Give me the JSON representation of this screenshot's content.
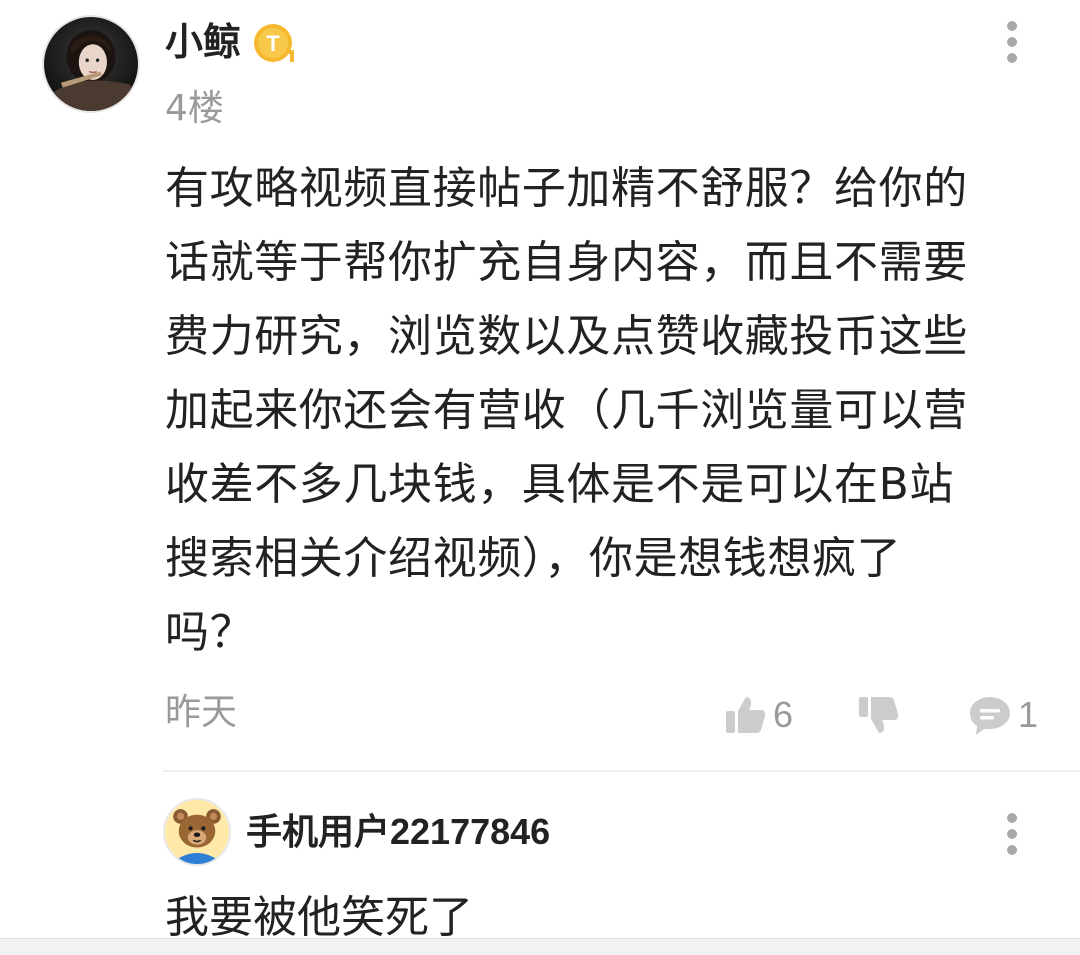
{
  "main_comment": {
    "username": "小鲸",
    "level_badge": {
      "icon": "level-t-badge-icon",
      "letter": "T",
      "color": "#F5B82E"
    },
    "floor": "4楼",
    "text_lines": [
      "有攻略视频直接帖子加精不舒服？给你的",
      "话就等于帮你扩充自身内容，而且不需要",
      "费力研究，浏览数以及点赞收藏投币这些",
      "加起来你还会有营收（几千浏览量可以营",
      "收差不多几块钱，具体是不是可以在B站",
      "搜索相关介绍视频），你是想钱想疯了",
      "吗？"
    ],
    "time": "昨天",
    "like_count": "6",
    "reply_count": "1"
  },
  "reply": {
    "username": "手机用户22177846",
    "text": "我要被他笑死了"
  },
  "colors": {
    "primary_text": "#222222",
    "secondary_text": "#9A9A9A",
    "icon_gray": "#CCCCCC",
    "divider": "#EEEEEE",
    "badge": "#F5B82E"
  }
}
